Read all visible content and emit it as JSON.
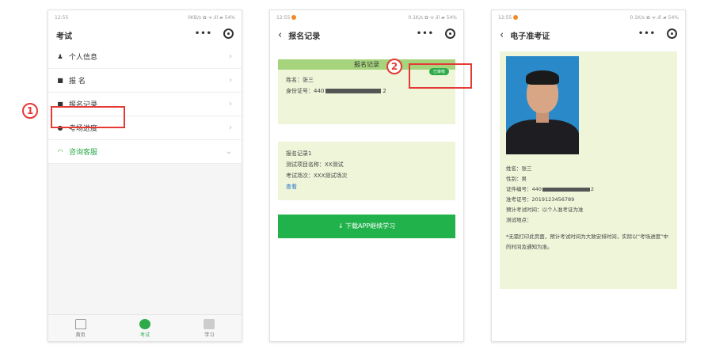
{
  "phone1": {
    "status_time": "12:55",
    "status_right": "0KB/s ✿ ᯤ.ıll ▰ 54%",
    "title": "考试",
    "menu": [
      {
        "icon": "person-icon",
        "glyph": "♟",
        "label": "个人信息"
      },
      {
        "icon": "list-icon",
        "glyph": "■",
        "label": "报 名"
      },
      {
        "icon": "record-icon",
        "glyph": "■",
        "label": "报名记录"
      },
      {
        "icon": "progress-icon",
        "glyph": "●",
        "label": "考场进度"
      },
      {
        "icon": "headset-icon",
        "glyph": "◠",
        "label": "咨询客服"
      }
    ],
    "tabs": [
      {
        "label": "首页"
      },
      {
        "label": "考试"
      },
      {
        "label": "学习"
      }
    ],
    "step_number": "1"
  },
  "phone2": {
    "status_time": "12:55",
    "status_right": "0.1K/s ✿ ᯤ.ıll ▰ 54%",
    "title": "报名记录",
    "card1": {
      "head": "报名记录",
      "name_line": "姓名：张三",
      "id_prefix": "身份证号：440",
      "id_suffix": "2"
    },
    "badge": "已审核",
    "card2": {
      "line1": "报名记录1",
      "line2": "测试项目名称：XX测试",
      "line3": "考试场次：XXX测试场次",
      "link": "查看"
    },
    "download_button": "↓ 下载APP继续学习",
    "step_number": "2"
  },
  "phone3": {
    "status_time": "12:55",
    "status_right": "0.1K/s ✿ ᯤ.ıll ▰ 54%",
    "title": "电子准考证",
    "lines": {
      "name": "姓名：张三",
      "gender": "性别：男",
      "id_prefix": "证件编号：440",
      "id_suffix": "2",
      "ticket_no": "准考证号：2019123456789",
      "exam_time": "预计考试时间：以个人准考证为准",
      "exam_place": "测试地点："
    },
    "note": "*无需打印此页面，预计考试时间为大致安排时间，实际以“考场进度”中的时间及通知为准。"
  }
}
